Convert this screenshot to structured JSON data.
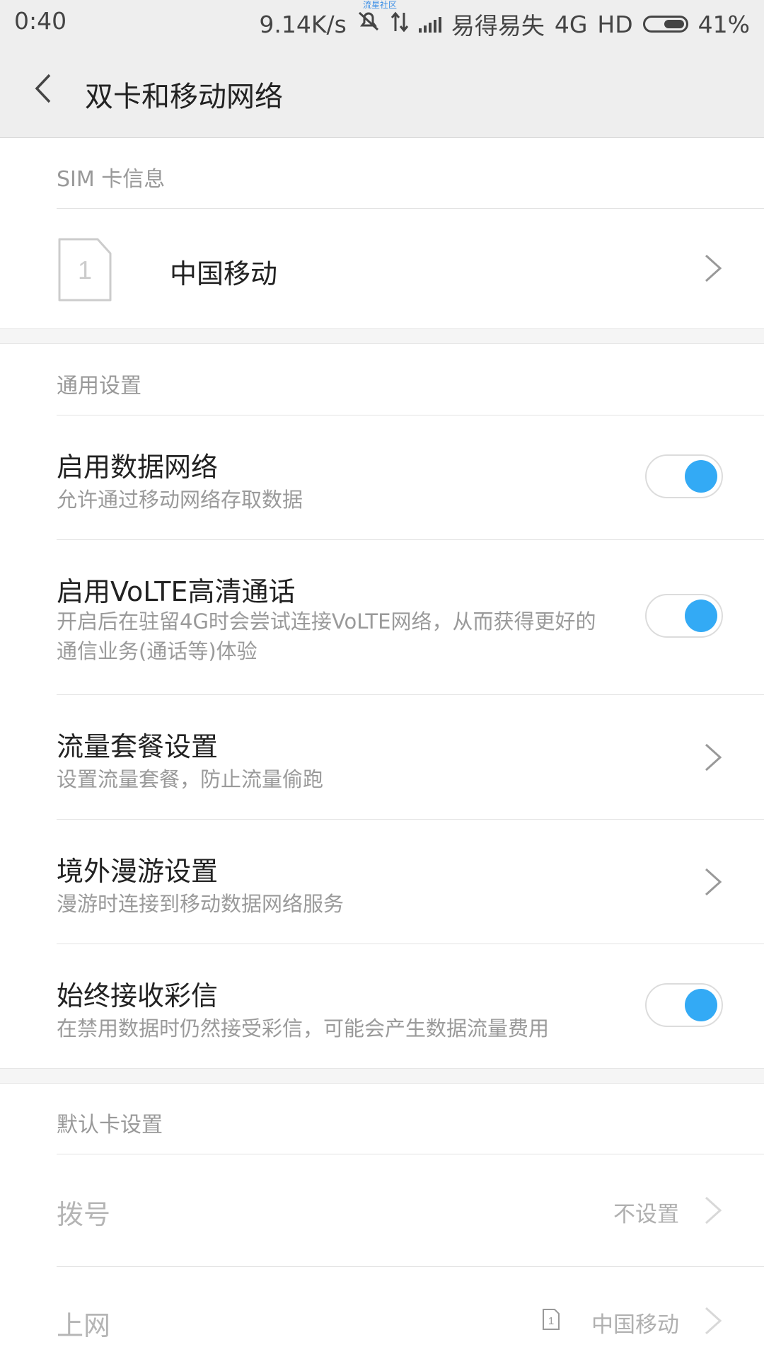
{
  "status_bar": {
    "time": "0:40",
    "speed": "9.14K/s",
    "carrier": "易得易失",
    "network": "4G",
    "hd": "HD",
    "battery": "41%",
    "watermark": "流星社区"
  },
  "header": {
    "title": "双卡和移动网络"
  },
  "sim_section": {
    "title": "SIM 卡信息",
    "sim_number": "1",
    "carrier_name": "中国移动"
  },
  "general_section": {
    "title": "通用设置",
    "items": [
      {
        "label": "启用数据网络",
        "sub": "允许通过移动网络存取数据",
        "type": "toggle",
        "on": true
      },
      {
        "label": "启用VoLTE高清通话",
        "sub": "开启后在驻留4G时会尝试连接VoLTE网络，从而获得更好的通信业务(通话等)体验",
        "type": "toggle",
        "on": true
      },
      {
        "label": "流量套餐设置",
        "sub": "设置流量套餐，防止流量偷跑",
        "type": "link"
      },
      {
        "label": "境外漫游设置",
        "sub": "漫游时连接到移动数据网络服务",
        "type": "link"
      },
      {
        "label": "始终接收彩信",
        "sub": "在禁用数据时仍然接受彩信，可能会产生数据流量费用",
        "type": "toggle",
        "on": true
      }
    ]
  },
  "default_section": {
    "title": "默认卡设置",
    "items": [
      {
        "label": "拨号",
        "value": "不设置"
      },
      {
        "label": "上网",
        "value": "中国移动",
        "sim_number": "1"
      }
    ]
  },
  "colors": {
    "accent": "#33aaf5",
    "header_bg": "#eeeeee"
  }
}
